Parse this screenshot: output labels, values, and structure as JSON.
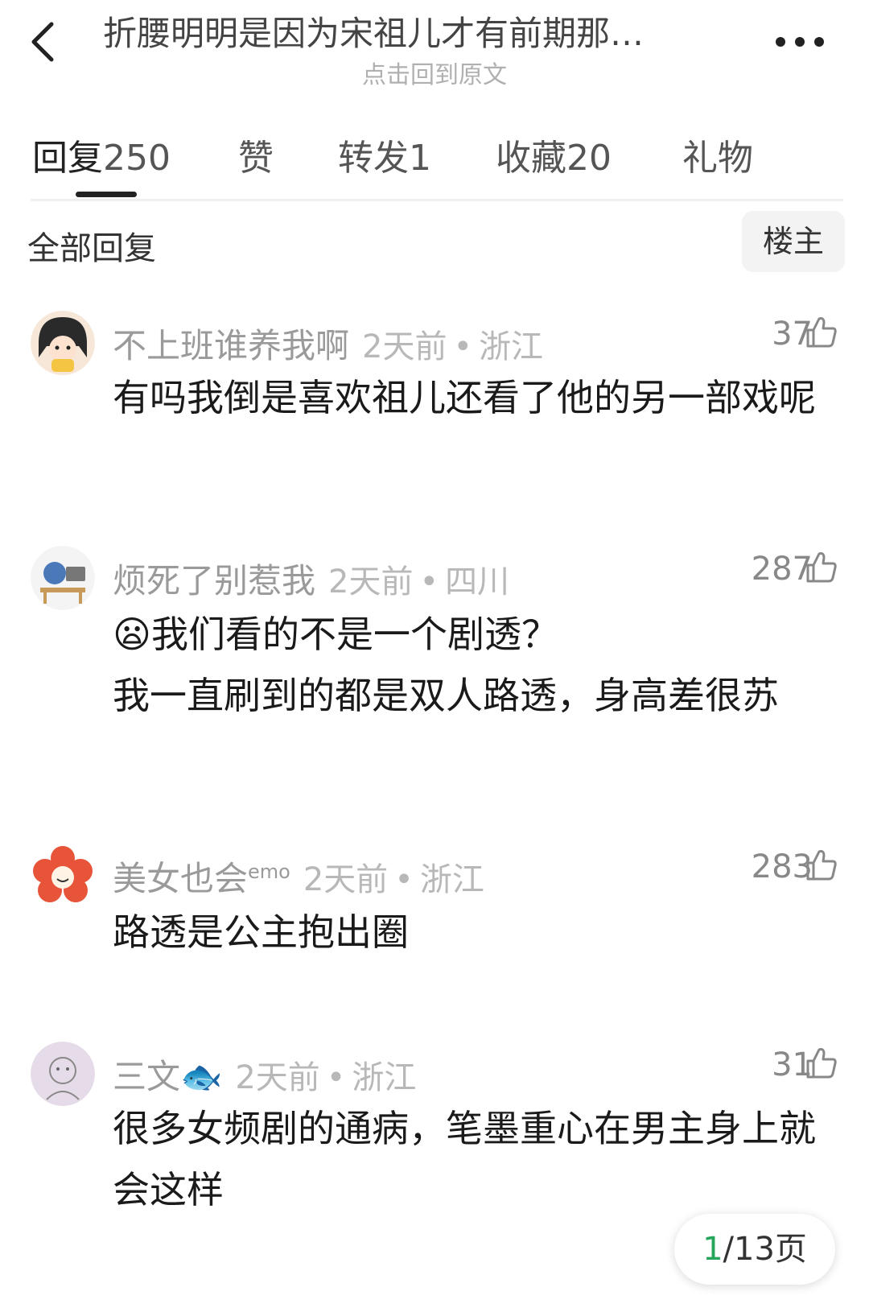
{
  "header": {
    "title": "折腰明明是因为宋祖儿才有前期那…",
    "subtitle": "点击回到原文"
  },
  "tabs": [
    {
      "label": "回复",
      "count": "250"
    },
    {
      "label": "赞",
      "count": ""
    },
    {
      "label": "转发",
      "count": "1"
    },
    {
      "label": "收藏",
      "count": "20"
    },
    {
      "label": "礼物",
      "count": ""
    }
  ],
  "section": {
    "title": "全部回复",
    "op_filter": "楼主"
  },
  "comments": [
    {
      "username": "不上班谁养我啊",
      "time": "2天前",
      "location": "浙江",
      "likes": "37",
      "text": "有吗我倒是喜欢祖儿还看了他的另一部戏呢"
    },
    {
      "username": "烦死了别惹我",
      "time": "2天前",
      "location": "四川",
      "likes": "287",
      "emoji": "😦",
      "line1": "我们看的不是一个剧透？",
      "text": "我一直刷到的都是双人路透，身高差很苏"
    },
    {
      "username": "美女也会",
      "username_suffix": "emo",
      "time": "2天前",
      "location": "浙江",
      "likes": "283",
      "text": "路透是公主抱出圈"
    },
    {
      "username": "三文",
      "username_emoji": "🐟",
      "time": "2天前",
      "location": "浙江",
      "likes": "31",
      "text": "很多女频剧的通病，笔墨重心在男主身上就会这样"
    }
  ],
  "pager": {
    "current": "1",
    "total": "/13页"
  }
}
